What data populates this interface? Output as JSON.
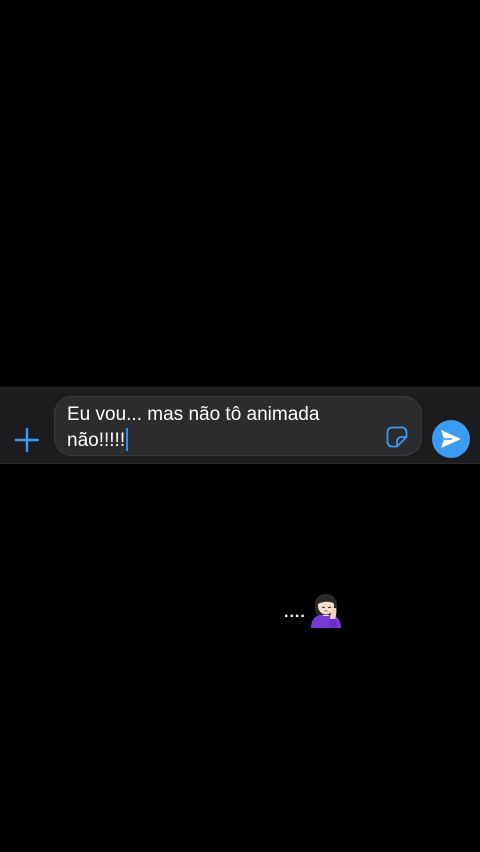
{
  "composer": {
    "message_text": "Eu vou... mas não tô animada\nnão!!!!!",
    "plus_icon": "plus-icon",
    "sticker_icon": "sticker-icon",
    "send_icon": "paper-plane-icon",
    "accent_color": "#3b9cf0"
  },
  "caption": {
    "dots": "....",
    "emoji_icon": "woman-facepalming-emoji"
  }
}
